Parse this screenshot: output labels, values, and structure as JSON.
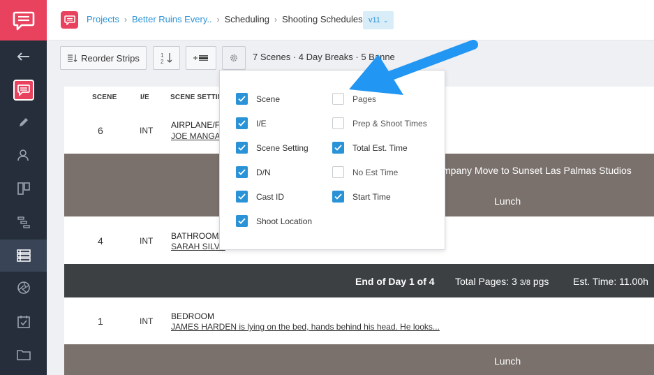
{
  "header": {
    "breadcrumb": [
      "Projects",
      "Better Ruins Every..",
      "Scheduling",
      "Shooting Schedules"
    ],
    "version": "v11"
  },
  "toolbar": {
    "reorder_label": "Reorder Strips",
    "counts": "7 Scenes · 4 Day Breaks · 5 Banne"
  },
  "table": {
    "headers": [
      "SCENE",
      "I/E",
      "SCENE SETTIN"
    ],
    "rows": [
      {
        "scene": "6",
        "ie": "INT",
        "setting": "AIRPLANE/FI",
        "desc": "JOE MANGAN"
      },
      {
        "scene": "4",
        "ie": "INT",
        "setting": "BATHROOM/",
        "desc": "SARAH SILVE"
      },
      {
        "scene": "1",
        "ie": "INT",
        "setting": "BEDROOM",
        "desc": "JAMES HARDEN is lying on the bed, hands behind his head. He looks..."
      }
    ],
    "banners": {
      "company_move": "mpany Move to Sunset Las Palmas Studios",
      "lunch1": "Lunch",
      "lunch2": "Lunch"
    },
    "day_end": {
      "label": "End of Day 1 of 4",
      "pages_label": "Total Pages:",
      "pages_value": "3",
      "pages_fraction": "3/8",
      "pages_unit": "pgs",
      "time_label": "Est. Time:",
      "time_value": "11.00h"
    }
  },
  "dropdown": {
    "left": [
      {
        "label": "Scene",
        "checked": true
      },
      {
        "label": "I/E",
        "checked": true
      },
      {
        "label": "Scene Setting",
        "checked": true
      },
      {
        "label": "D/N",
        "checked": true
      },
      {
        "label": "Cast ID",
        "checked": true
      },
      {
        "label": "Shoot Location",
        "checked": true
      }
    ],
    "right": [
      {
        "label": "Pages",
        "checked": false
      },
      {
        "label": "Prep & Shoot Times",
        "checked": false
      },
      {
        "label": "Total Est. Time",
        "checked": true
      },
      {
        "label": "No Est Time",
        "checked": false
      },
      {
        "label": "Start Time",
        "checked": true
      }
    ]
  },
  "colors": {
    "accent": "#2a92d6",
    "brand": "#e8425e",
    "sidebar": "#252e3a",
    "banner_gray": "#7a716c",
    "banner_dark": "#3c4043",
    "arrow": "#2196f3"
  },
  "icons": {
    "sidebar": [
      "speech-bubble-logo",
      "back-arrow-icon",
      "project-logo-icon",
      "pencil-icon",
      "people-icon",
      "board-icon",
      "timeline-icon",
      "schedule-list-icon",
      "aperture-icon",
      "calendar-icon",
      "folder-icon"
    ]
  }
}
